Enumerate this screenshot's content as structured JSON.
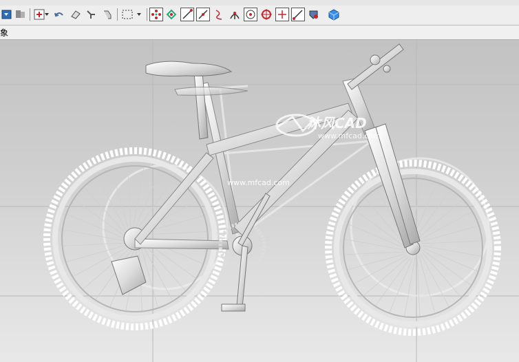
{
  "toolbar": {
    "icons": [
      "view-dropdown-icon",
      "layer-icon",
      "snap-point-icon",
      "undo-icon",
      "rotate-view-icon",
      "pan-view-icon",
      "hand-icon",
      "select-box-icon",
      "dropdown-arrow-icon",
      "point-set-icon",
      "snap-point-alt-icon",
      "line-icon",
      "line-angle-icon",
      "curve-icon",
      "intersection-icon",
      "center-point-icon",
      "circle-quadrant-icon",
      "cross-point-icon",
      "line-end-icon",
      "settings-icon",
      "cube-icon"
    ]
  },
  "label_bar": {
    "text": "象"
  },
  "viewport": {
    "watermark_brand": "沐风CAD",
    "watermark_url": "www.mfcad.com",
    "watermark_url_center": "www.mfcad.com"
  },
  "colors": {
    "viewport_top": "#c2c2c2",
    "viewport_bottom": "#e8e8e8",
    "accent_red": "#c0272d",
    "cube_blue": "#3a8ee6"
  }
}
